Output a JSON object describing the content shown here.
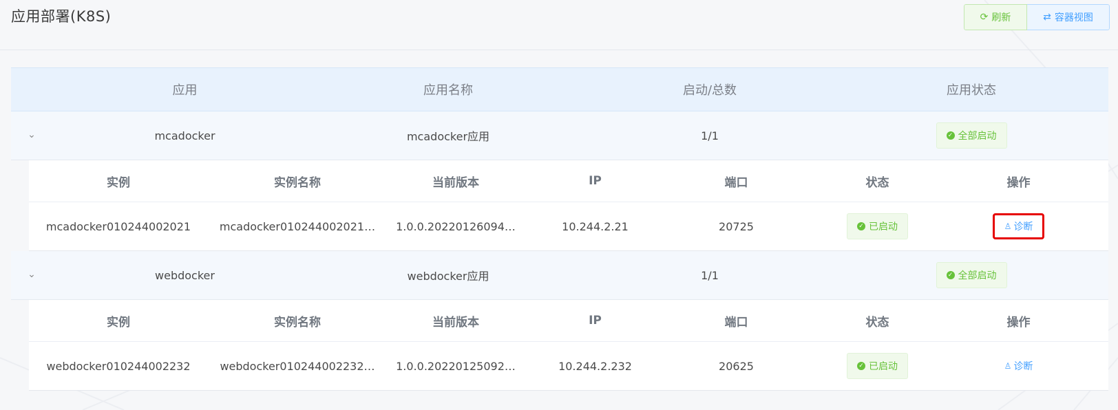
{
  "page": {
    "title": "应用部署(K8S)"
  },
  "toolbar": {
    "refresh_label": "刷新",
    "container_view_label": "容器视图"
  },
  "table": {
    "headers": [
      "应用",
      "应用名称",
      "启动/总数",
      "应用状态"
    ],
    "sub_headers": [
      "实例",
      "实例名称",
      "当前版本",
      "IP",
      "端口",
      "状态",
      "操作"
    ],
    "apps": [
      {
        "app": "mcadocker",
        "name": "mcadocker应用",
        "count": "1/1",
        "status": "全部启动",
        "instances": [
          {
            "instance": "mcadocker010244002021",
            "instance_name": "mcadocker010244002021…",
            "version": "1.0.0.20220126094…",
            "ip": "10.244.2.21",
            "port": "20725",
            "status": "已启动",
            "action": "诊断"
          }
        ]
      },
      {
        "app": "webdocker",
        "name": "webdocker应用",
        "count": "1/1",
        "status": "全部启动",
        "instances": [
          {
            "instance": "webdocker010244002232",
            "instance_name": "webdocker010244002232…",
            "version": "1.0.0.20220125092…",
            "ip": "10.244.2.232",
            "port": "20625",
            "status": "已启动",
            "action": "诊断"
          }
        ]
      }
    ]
  },
  "colors": {
    "success": "#67c23a",
    "primary": "#409eff",
    "highlight": "#e60000",
    "header_bg": "#e8f2fd"
  },
  "icons": {
    "refresh": "refresh-icon",
    "switch": "switch-icon",
    "expand": "chevron-down-icon",
    "check": "check-circle-icon",
    "diagnose": "stethoscope-icon"
  }
}
